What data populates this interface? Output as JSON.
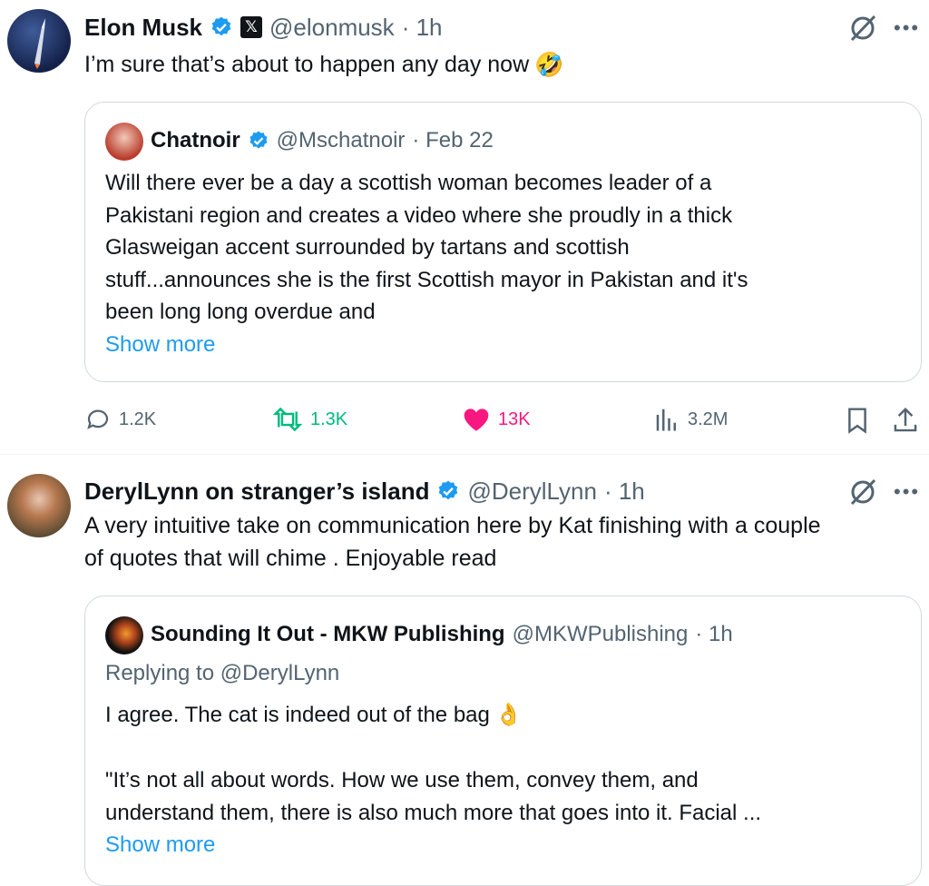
{
  "tweet1": {
    "author_name": "Elon Musk",
    "handle": "@elonmusk",
    "time": "· 1h",
    "text": "I’m sure that’s about to happen any day now",
    "emoji": "🤣",
    "quote": {
      "author_name": "Chatnoir",
      "handle": "@Mschatnoir",
      "time": "· Feb 22",
      "lines": [
        "Will there ever be a day a scottish woman becomes leader of a",
        "Pakistani region and creates a video where she proudly in a thick",
        "Glasweigan accent surrounded by tartans and scottish",
        "stuff...announces she is the first Scottish mayor in Pakistan and it's",
        "been long long overdue and"
      ],
      "show_more": "Show more"
    },
    "metrics": {
      "replies": "1.2K",
      "reposts": "1.3K",
      "likes": "13K",
      "views": "3.2M"
    },
    "colors": {
      "repost": "#00ba7c",
      "like": "#f91880",
      "verified": "#1d9bf0"
    }
  },
  "tweet2": {
    "author_name": "DerylLynn on stranger’s island",
    "handle": "@DerylLynn",
    "time": "· 1h",
    "lines": [
      "A very intuitive take on communication here by Kat finishing with a couple",
      "of quotes that will chime . Enjoyable read"
    ],
    "quote": {
      "author_name": "Sounding It Out - MKW Publishing",
      "handle": "@MKWPublishing",
      "time": "· 1h",
      "replying_to": "Replying to @DerylLynn",
      "line1": "I agree. The cat is indeed out of the bag",
      "emoji": "👌",
      "lines": [
        "\"It’s not all about words. How we use them, convey them, and",
        "understand them, there is also much more that goes into it. Facial ..."
      ],
      "show_more": "Show more"
    }
  }
}
